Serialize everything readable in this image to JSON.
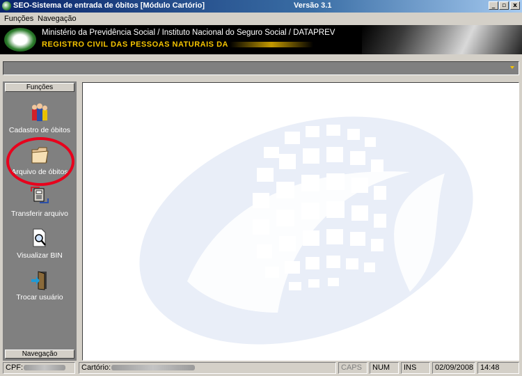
{
  "window": {
    "title": "SEO-Sistema de entrada de óbitos [Módulo Cartório]",
    "version": "Versão 3.1",
    "buttons": {
      "minimize": "_",
      "restore": "▫",
      "close": "x"
    }
  },
  "menu": {
    "items": [
      {
        "label": "Funções"
      },
      {
        "label": "Navegação"
      }
    ]
  },
  "banner": {
    "line1": "Ministério da Previdência Social / Instituto Nacional do Seguro Social / DATAPREV",
    "line2": "REGISTRO CIVIL DAS PESSOAS NATURAIS DA"
  },
  "sidebar": {
    "header": "Funções",
    "footer": "Navegação",
    "items": [
      {
        "label": "Cadastro de óbitos",
        "icon": "people-icon"
      },
      {
        "label": "Arquivo de óbitos",
        "icon": "folder-icon"
      },
      {
        "label": "Transferir arquivo",
        "icon": "transfer-icon"
      },
      {
        "label": "Visualizar BIN",
        "icon": "magnifier-document-icon"
      },
      {
        "label": "Trocar usuário",
        "icon": "exit-door-icon"
      }
    ]
  },
  "statusbar": {
    "cpf_label": "CPF:",
    "cartorio_label": "Cartório:",
    "caps": "CAPS",
    "num": "NUM",
    "ins": "INS",
    "date": "02/09/2008",
    "time": "14:48"
  },
  "colors": {
    "highlight_circle": "#e8001c",
    "watermark": "#e9eef8",
    "banner_accent": "#f5c400"
  }
}
